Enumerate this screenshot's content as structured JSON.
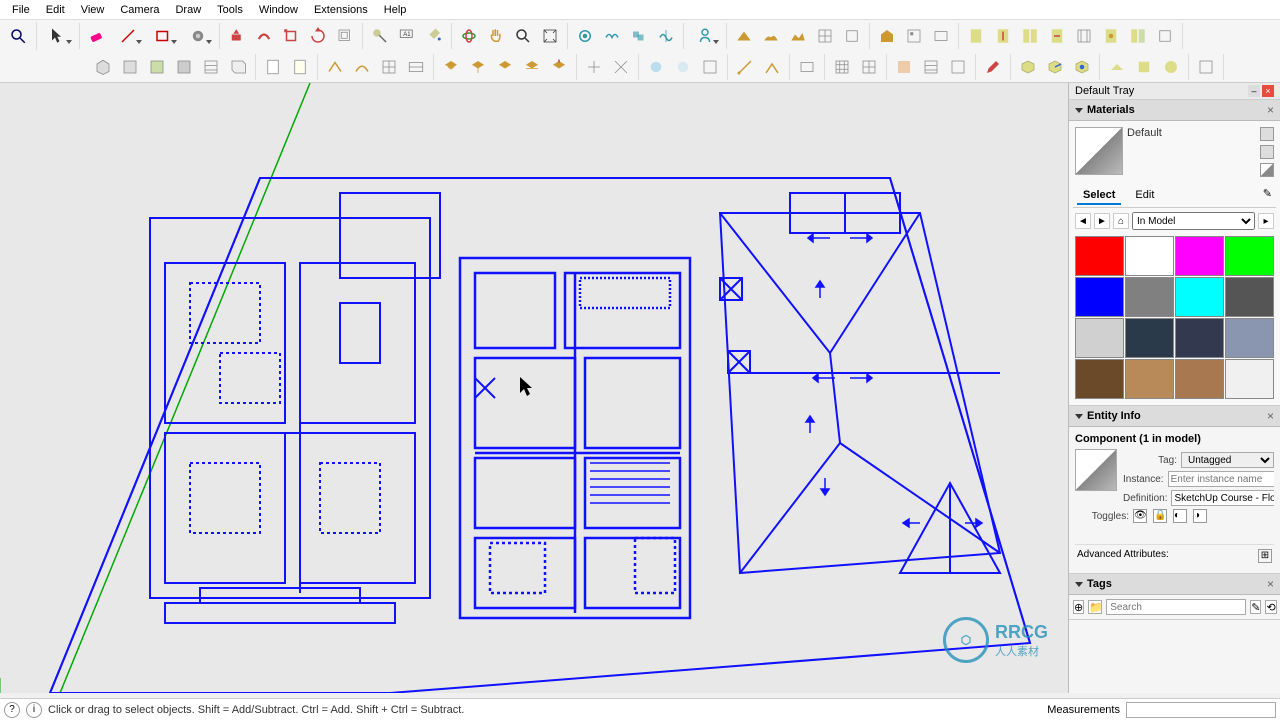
{
  "menu": [
    "File",
    "Edit",
    "View",
    "Camera",
    "Draw",
    "Tools",
    "Window",
    "Extensions",
    "Help"
  ],
  "tray": {
    "title": "Default Tray",
    "materials": {
      "title": "Materials",
      "current": "Default",
      "tabs": {
        "select": "Select",
        "edit": "Edit"
      },
      "collection": "In Model",
      "swatches": [
        "#ff0000",
        "#ffffff",
        "#ff00ff",
        "#00ff00",
        "#0000ff",
        "#808080",
        "#00ffff",
        "#555555",
        "#d0d0d0",
        "#2a3a4a",
        "#333a50",
        "#8a95b0",
        "#6b4a2a",
        "#b88a5a",
        "#a87850",
        "#f0f0f0"
      ]
    },
    "entity": {
      "title": "Entity Info",
      "header": "Component (1 in model)",
      "tag_label": "Tag:",
      "tag_value": "Untagged",
      "instance_label": "Instance:",
      "instance_placeholder": "Enter instance name",
      "definition_label": "Definition:",
      "definition_value": "SketchUp Course - Floo",
      "toggles_label": "Toggles:",
      "adv": "Advanced Attributes:"
    },
    "tags": {
      "title": "Tags",
      "search_placeholder": "Search"
    }
  },
  "status": {
    "tip": "Click or drag to select objects. Shift = Add/Subtract. Ctrl = Add. Shift + Ctrl = Subtract.",
    "meas_label": "Measurements"
  },
  "wm": {
    "brand": "RRCG",
    "sub": "人人素材"
  }
}
